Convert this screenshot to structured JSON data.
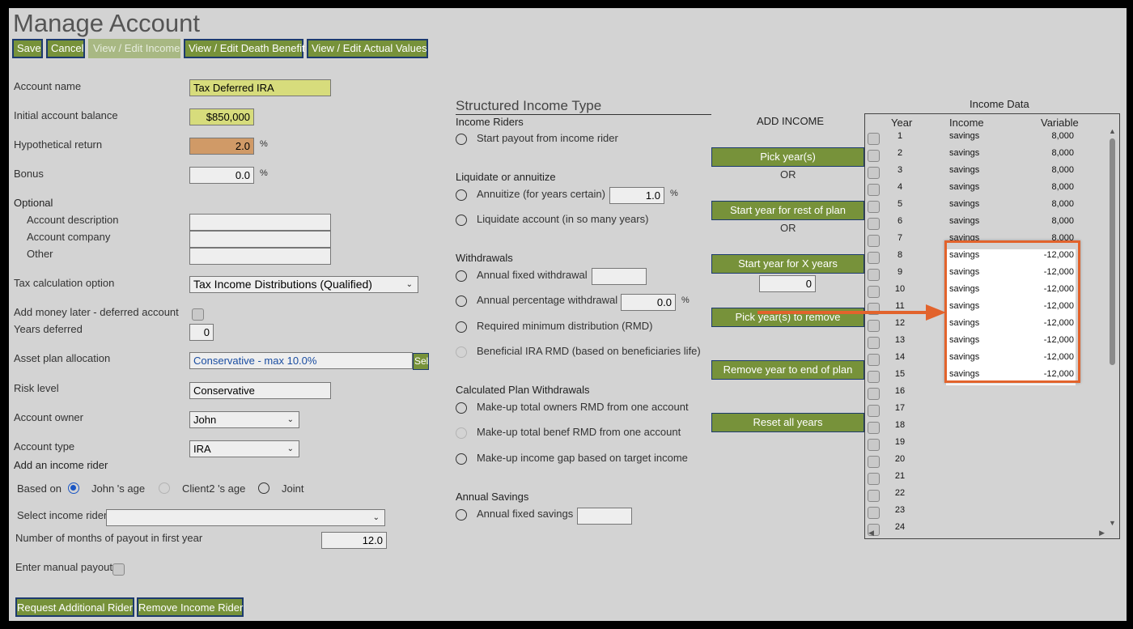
{
  "page": {
    "title": "Manage Account"
  },
  "toolbar": {
    "save": "Save",
    "cancel": "Cancel",
    "view_income": "View / Edit Income",
    "view_death": "View / Edit Death Benefit",
    "view_actual": "View / Edit Actual Values"
  },
  "form": {
    "account_name": {
      "label": "Account name",
      "value": "Tax Deferred IRA"
    },
    "initial_balance": {
      "label": "Initial account balance",
      "value": "$850,000"
    },
    "hypothetical_return": {
      "label": "Hypothetical return",
      "value": "2.0",
      "unit": "%"
    },
    "bonus": {
      "label": "Bonus",
      "value": "0.0",
      "unit": "%"
    },
    "optional": {
      "label": "Optional",
      "description": "Account description",
      "company": "Account company",
      "other": "Other"
    },
    "tax_option": {
      "label": "Tax calculation option",
      "value": "Tax Income Distributions (Qualified)"
    },
    "add_money_later": {
      "label": "Add money later - deferred account"
    },
    "years_deferred": {
      "label": "Years deferred",
      "value": "0"
    },
    "asset_plan": {
      "label": "Asset plan allocation",
      "value": "Conservative - max 10.0%",
      "button": "Sel"
    },
    "risk_level": {
      "label": "Risk level",
      "value": "Conservative"
    },
    "account_owner": {
      "label": "Account owner",
      "value": "John"
    },
    "account_type": {
      "label": "Account type",
      "value": "IRA"
    },
    "income_rider": {
      "heading": "Add an income rider",
      "based_on": "Based on",
      "opt1": "John 's age",
      "opt2": "Client2 's age",
      "opt3": "Joint",
      "select_label": "Select income rider",
      "months_label": "Number of months of payout in first year",
      "months_value": "12.0",
      "manual_label": "Enter manual payout"
    },
    "btn_request": "Request Additional Rider",
    "btn_remove": "Remove Income Rider"
  },
  "structured": {
    "heading": "Structured Income Type",
    "income_riders": "Income Riders",
    "start_payout": "Start payout from income rider",
    "liquidate_heading": "Liquidate or annuitize",
    "annuitize": "Annuitize (for years certain)",
    "annuitize_value": "1.0",
    "pct": "%",
    "liquidate": "Liquidate account (in so many years)",
    "withdrawals_heading": "Withdrawals",
    "annual_fixed": "Annual fixed withdrawal",
    "annual_pct": "Annual percentage withdrawal",
    "annual_pct_value": "0.0",
    "rmd": "Required minimum distribution (RMD)",
    "beneficial_rmd": "Beneficial IRA RMD (based on beneficiaries life)",
    "calc_heading": "Calculated Plan Withdrawals",
    "makeup_owner": "Make-up total owners RMD from one account",
    "makeup_benef": "Make-up total benef RMD from one account",
    "makeup_gap": "Make-up income gap based on target income",
    "savings_heading": "Annual Savings",
    "annual_savings": "Annual fixed savings"
  },
  "add_income": {
    "heading": "ADD INCOME",
    "pick_years": "Pick year(s)",
    "or": "OR",
    "start_rest": "Start year for rest of plan",
    "start_x": "Start year for X years",
    "x_value": "0",
    "pick_remove": "Pick year(s) to remove",
    "remove_end": "Remove year to end of plan",
    "reset": "Reset all years"
  },
  "income_data": {
    "title": "Income Data",
    "col_year": "Year",
    "col_income": "Income",
    "col_variable": "Variable",
    "rows": [
      {
        "year": "1",
        "income": "savings",
        "variable": "8,000"
      },
      {
        "year": "2",
        "income": "savings",
        "variable": "8,000"
      },
      {
        "year": "3",
        "income": "savings",
        "variable": "8,000"
      },
      {
        "year": "4",
        "income": "savings",
        "variable": "8,000"
      },
      {
        "year": "5",
        "income": "savings",
        "variable": "8,000"
      },
      {
        "year": "6",
        "income": "savings",
        "variable": "8,000"
      },
      {
        "year": "7",
        "income": "savings",
        "variable": "8,000"
      },
      {
        "year": "8",
        "income": "savings",
        "variable": "-12,000"
      },
      {
        "year": "9",
        "income": "savings",
        "variable": "-12,000"
      },
      {
        "year": "10",
        "income": "savings",
        "variable": "-12,000"
      },
      {
        "year": "11",
        "income": "savings",
        "variable": "-12,000"
      },
      {
        "year": "12",
        "income": "savings",
        "variable": "-12,000"
      },
      {
        "year": "13",
        "income": "savings",
        "variable": "-12,000"
      },
      {
        "year": "14",
        "income": "savings",
        "variable": "-12,000"
      },
      {
        "year": "15",
        "income": "savings",
        "variable": "-12,000"
      },
      {
        "year": "16",
        "income": "",
        "variable": ""
      },
      {
        "year": "17",
        "income": "",
        "variable": ""
      },
      {
        "year": "18",
        "income": "",
        "variable": ""
      },
      {
        "year": "19",
        "income": "",
        "variable": ""
      },
      {
        "year": "20",
        "income": "",
        "variable": ""
      },
      {
        "year": "21",
        "income": "",
        "variable": ""
      },
      {
        "year": "22",
        "income": "",
        "variable": ""
      },
      {
        "year": "23",
        "income": "",
        "variable": ""
      },
      {
        "year": "24",
        "income": "",
        "variable": ""
      }
    ]
  },
  "colors": {
    "button_green": "#77923a",
    "button_border": "#1c3a6e",
    "highlight_orange": "#e2632c",
    "field_yellow": "#d7dc7c",
    "field_orange": "#d09a67"
  }
}
